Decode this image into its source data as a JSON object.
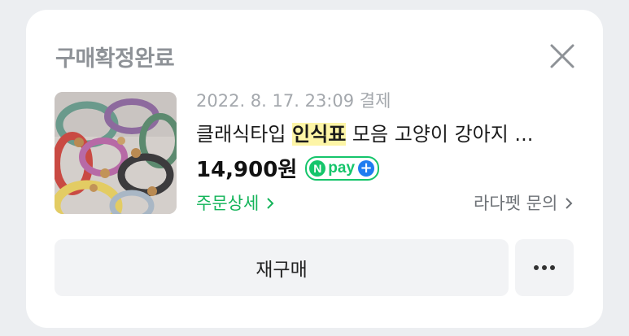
{
  "order": {
    "status_label": "구매확정완료",
    "date_text": "2022. 8. 17. 23:09 결제",
    "title_prefix": "클래식타입 ",
    "title_highlight": "인식표",
    "title_suffix": " 모음 고양이 강아지 ...",
    "price": "14,900원",
    "payment_badge": {
      "icon_text": "N",
      "label": "pay",
      "plus": "+"
    },
    "order_detail_link": "주문상세",
    "seller_inquiry_link": "라다펫 문의",
    "rebuy_label": "재구매",
    "more_label": "•••"
  },
  "icons": {
    "close": "close-icon",
    "more": "more-dots-icon",
    "chevron": "chevron-right-icon"
  },
  "colors": {
    "status_gray": "#8e9297",
    "npay_green": "#15c56b",
    "npay_blue": "#1e7cf0",
    "link_green": "#14b45a",
    "highlight": "#fdf5a6"
  }
}
